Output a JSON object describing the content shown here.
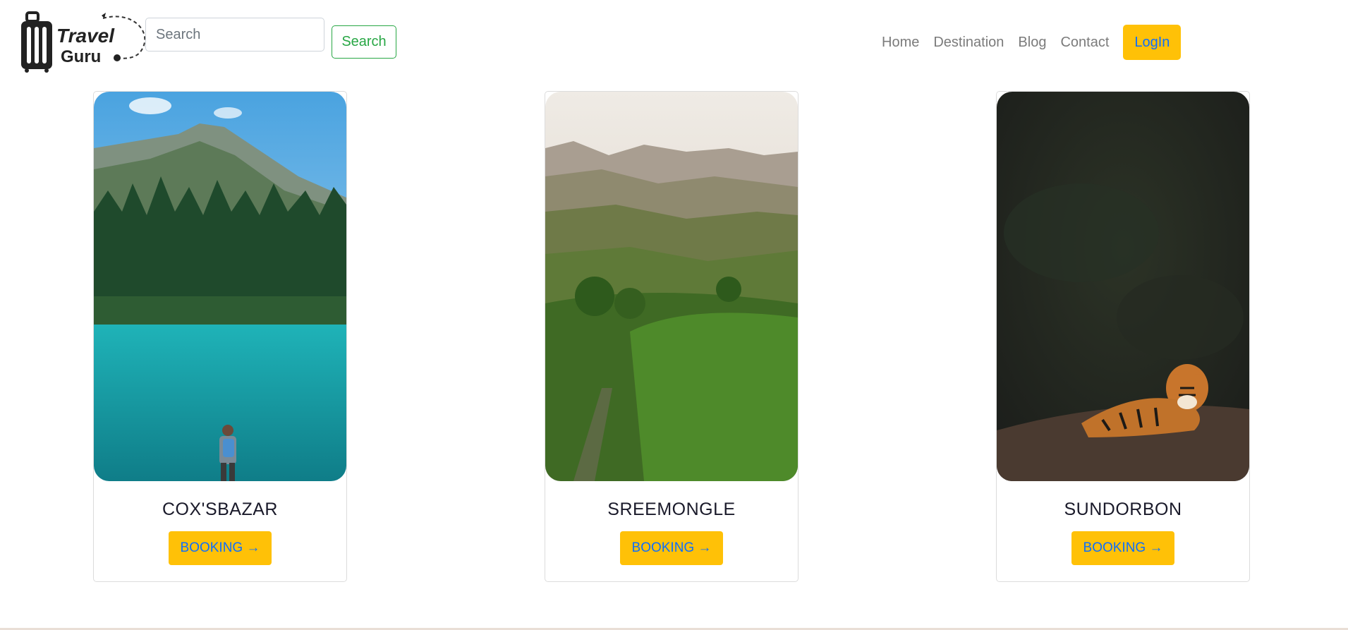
{
  "brand": {
    "line1": "Travel",
    "line2": "Guru"
  },
  "search": {
    "placeholder": "Search",
    "button_label": "Search"
  },
  "nav": {
    "items": [
      "Home",
      "Destination",
      "Blog",
      "Contact"
    ],
    "login_label": "LogIn"
  },
  "destinations": [
    {
      "title": "COX'SBAZAR",
      "button": "BOOKING →",
      "image": "mountain-lake-hiker-photo"
    },
    {
      "title": "SREEMONGLE",
      "button": "BOOKING →",
      "image": "tea-garden-hills-photo"
    },
    {
      "title": "SUNDORBON",
      "button": "BOOKING →",
      "image": "tiger-forest-photo"
    }
  ],
  "colors": {
    "accent": "#ffc107",
    "link_blue": "#0d6efd",
    "search_green": "#28a745",
    "nav_text": "#7b7b7b"
  }
}
